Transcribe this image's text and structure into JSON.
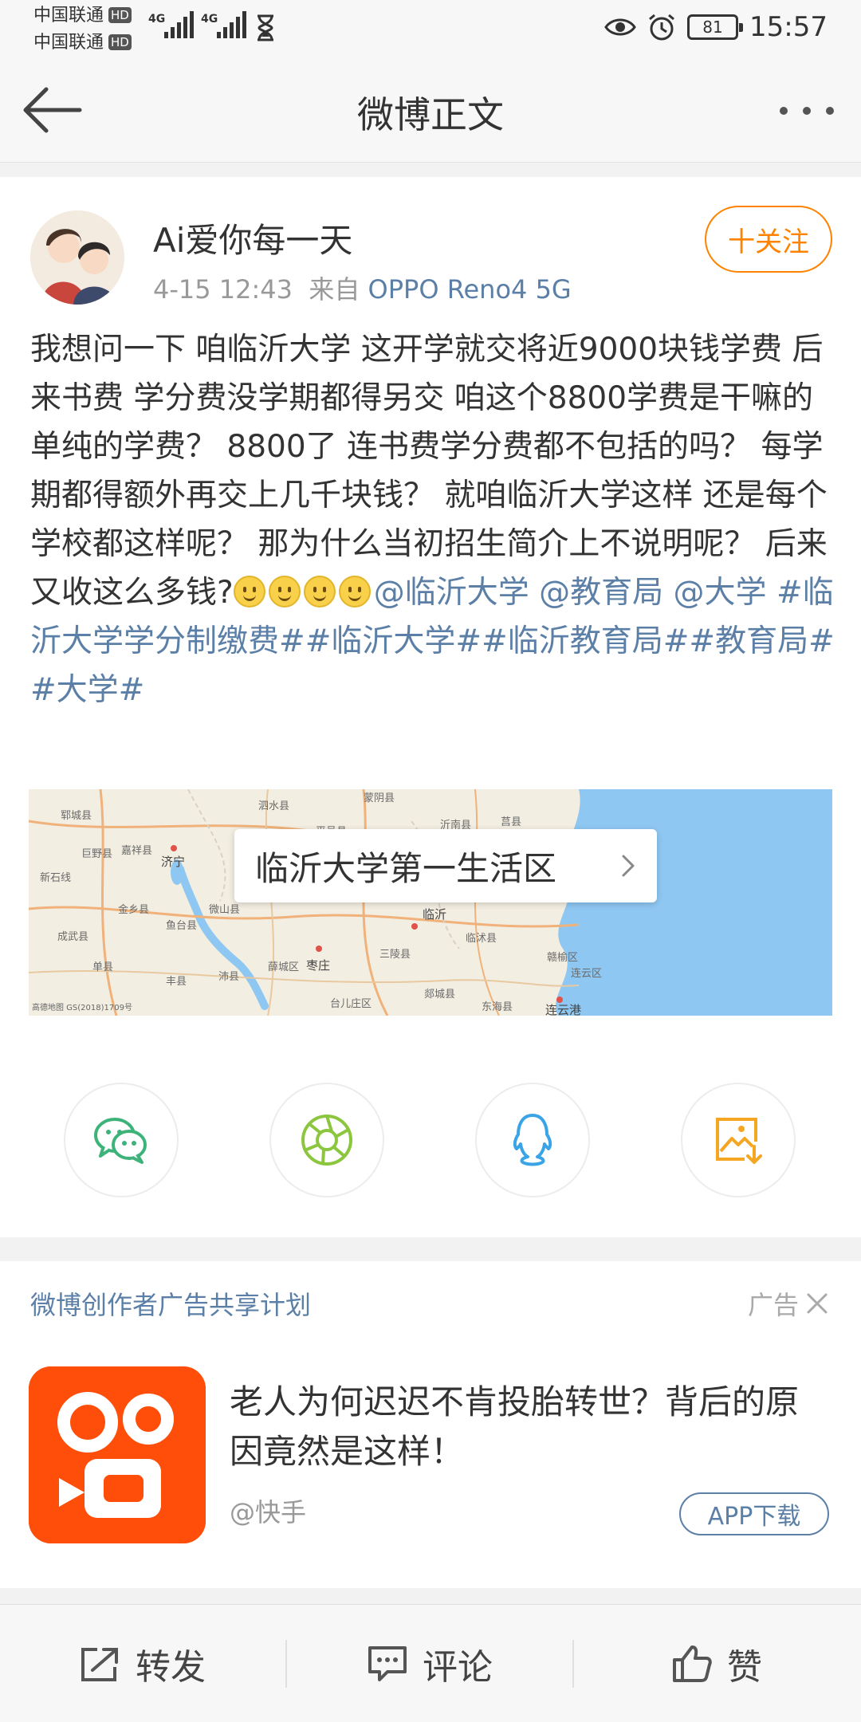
{
  "status_bar": {
    "carrier1": "中国联通",
    "carrier2": "中国联通",
    "hd_label": "HD",
    "network1": "4G",
    "network2": "4G",
    "battery": "81",
    "time": "15:57"
  },
  "nav": {
    "title": "微博正文"
  },
  "post": {
    "author": "Ai爱你每一天",
    "time": "4-15 12:43",
    "source_prefix": "来自",
    "device": "OPPO Reno4 5G",
    "follow_label": "十关注",
    "text_body": "我想问一下  咱临沂大学  这开学就交将近9000块钱学费   后来书费   学分费没学期都得另交    咱这个8800学费是干嘛的   单纯的学费？  8800了  连书费学分费都不包括的吗？  每学期都得额外再交上几千块钱？  就咱临沂大学这样  还是每个学校都这样呢？   那为什么当初招生简介上不说明呢？  后来又收这么多钱?",
    "mentions": [
      "@临沂大学",
      "@教育局",
      "@大学"
    ],
    "topics": [
      "#临沂大学学分制缴费#",
      "#临沂大学#",
      "#临沂教育局#",
      "#教育局#",
      "#大学#"
    ],
    "location": "临沂大学第一生活区",
    "map_places": [
      "郓城县",
      "泗水县",
      "蒙阴县",
      "沂南县",
      "莒县",
      "巨野县",
      "嘉祥县",
      "济宁",
      "平邑县",
      "新石线",
      "金乡县",
      "鱼台县",
      "微山县",
      "临沂",
      "临沭县",
      "成武县",
      "单县",
      "丰县",
      "沛县",
      "薛城区",
      "枣庄",
      "三陵县",
      "郯城县",
      "台儿庄区",
      "东海县",
      "连云港",
      "赣榆区",
      "连云区"
    ],
    "map_copyright": "高德地图 GS(2018)1709号"
  },
  "share": {
    "items": [
      {
        "icon": "wechat-icon"
      },
      {
        "icon": "moments-icon"
      },
      {
        "icon": "qq-icon"
      },
      {
        "icon": "save-image-icon"
      }
    ]
  },
  "ad": {
    "plan_label": "微博创作者广告共享计划",
    "tag": "广告",
    "title": "老人为何迟迟不肯投胎转世？背后的原因竟然是这样！",
    "source": "@快手",
    "button": "APP下载"
  },
  "bottom": {
    "repost": "转发",
    "comment": "评论",
    "like": "赞"
  },
  "colors": {
    "accent_orange": "#ff8200",
    "link_blue": "#5b7fa6",
    "kuaishou_orange": "#ff4d0a"
  }
}
